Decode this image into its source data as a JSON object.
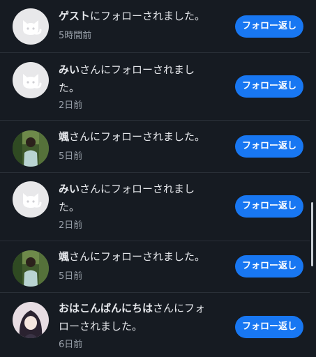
{
  "follow_button_label": "フォロー返し",
  "suffix_san_followed": "さんにフォローされました。",
  "suffix_followed": "にフォローされました。",
  "notifications": [
    {
      "name": "ゲスト",
      "message": "にフォローされました。",
      "time": "5時間前",
      "avatar": "default-cat-avatar"
    },
    {
      "name": "みい",
      "message": "さんにフォローされました。",
      "time": "2日前",
      "avatar": "default-cat-avatar"
    },
    {
      "name": "颯",
      "message": "さんにフォローされました。",
      "time": "5日前",
      "avatar": "photo-avatar-person-outdoors"
    },
    {
      "name": "みい",
      "message": "さんにフォローされました。",
      "time": "2日前",
      "avatar": "default-cat-avatar"
    },
    {
      "name": "颯",
      "message": "さんにフォローされました。",
      "time": "5日前",
      "avatar": "photo-avatar-person-outdoors"
    },
    {
      "name": "おはこんばんにちは",
      "message": "さんにフォローされました。",
      "time": "6日前",
      "avatar": "anime-girl-avatar"
    }
  ],
  "colors": {
    "background": "#161b22",
    "button": "#1877f2",
    "divider": "#2a3038",
    "muted_text": "#9aa1ab"
  }
}
